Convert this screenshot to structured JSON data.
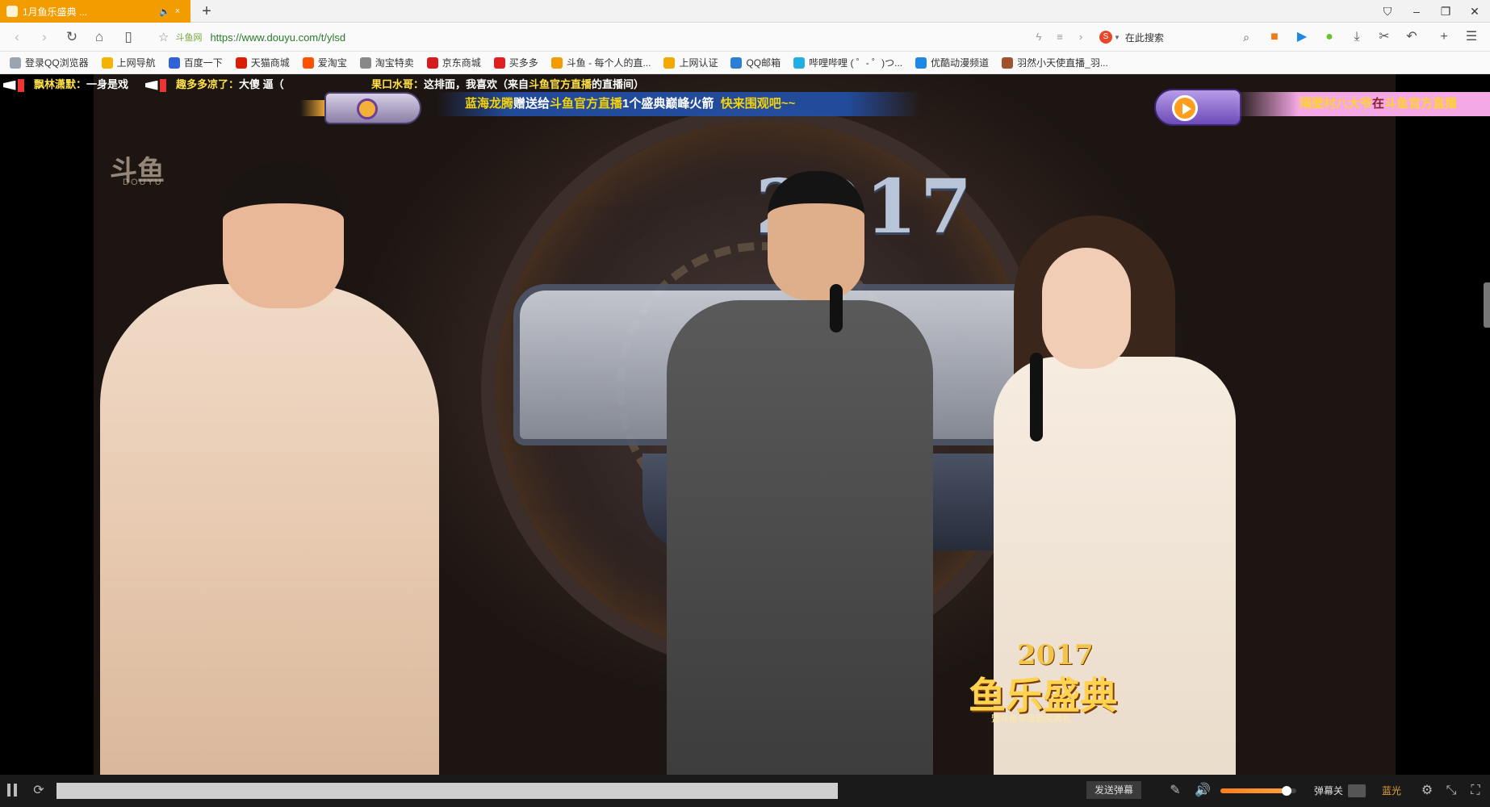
{
  "tab": {
    "title": "1月鱼乐盛典 ...",
    "mute_icon": "speaker-icon",
    "close_label": "×"
  },
  "newtab_label": "+",
  "window": {
    "minimize": "–",
    "restore": "❐",
    "close": "✕",
    "menu": "⛉"
  },
  "nav": {
    "site_name": "斗鱼网",
    "url": "https://www.douyu.com/t/ylsd",
    "search_placeholder": "在此搜索"
  },
  "bookmarks": [
    {
      "label": "登录QQ浏览器",
      "color": "#9aa5b1"
    },
    {
      "label": "上网导航",
      "color": "#f2b400"
    },
    {
      "label": "百度一下",
      "color": "#2f62d6"
    },
    {
      "label": "天猫商城",
      "color": "#d81e06"
    },
    {
      "label": "爱淘宝",
      "color": "#ff5000"
    },
    {
      "label": "淘宝特卖",
      "color": "#888888"
    },
    {
      "label": "京东商城",
      "color": "#d71a1b"
    },
    {
      "label": "买多多",
      "color": "#e02020"
    },
    {
      "label": "斗鱼 - 每个人的直...",
      "color": "#f39c00"
    },
    {
      "label": "上网认证",
      "color": "#f2a900"
    },
    {
      "label": "QQ邮箱",
      "color": "#2c7fd6"
    },
    {
      "label": "哔哩哔哩 ( ゜- ゜)つ...",
      "color": "#23ade5"
    },
    {
      "label": "优酷动漫频道",
      "color": "#1e88e5"
    },
    {
      "label": "羽然小天使直播_羽...",
      "color": "#a0522d"
    }
  ],
  "danmaku": {
    "d1_name": "飘林潇默：",
    "d1_text": "一身是戏",
    "d2_name": "趣多多凉了：",
    "d2_text": "大傻 逼（",
    "d3_name": "果口水哥：",
    "d3_text": "这排面，我喜欢（来自",
    "d3_link": "斗鱼官方直播",
    "d3_tail": "的直播间）"
  },
  "gift_banner": {
    "sender": "蓝海龙腾",
    "verb": "赠送给",
    "receiver": "斗鱼官方直播",
    "gift": "1个盛典巅峰火箭",
    "cta": "快来围观吧~~"
  },
  "gift_banner2": {
    "sender": "隔壁村八大爷",
    "verb": "在",
    "receiver": "斗鱼官方直播"
  },
  "video": {
    "backdrop_year": "2017",
    "watermark": "斗鱼",
    "watermark_sub": "DOUYU",
    "corner_year": "2017",
    "corner_title": "鱼乐盛典",
    "corner_sub": "暨斗鱼年度颁奖典礼"
  },
  "controls": {
    "send_label": "发送弹幕",
    "danmu_toggle_label": "弹幕关",
    "quality_label": "蓝光",
    "progress": 1.0,
    "volume": 0.87
  }
}
